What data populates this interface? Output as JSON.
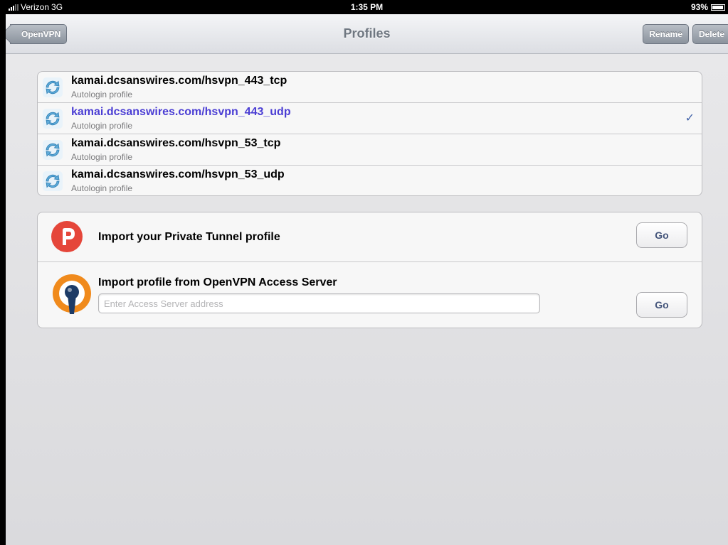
{
  "status_bar": {
    "carrier": "Verizon",
    "network": "3G",
    "time": "1:35 PM",
    "battery": "93%",
    "battery_level": 0.93
  },
  "nav": {
    "back_label": "OpenVPN",
    "title": "Profiles",
    "rename_label": "Rename",
    "delete_label": "Delete"
  },
  "profiles": [
    {
      "name": "kamai.dcsanswires.com/hsvpn_443_tcp",
      "subtitle": "Autologin profile",
      "selected": false,
      "icon": "refresh-icon"
    },
    {
      "name": "kamai.dcsanswires.com/hsvpn_443_udp",
      "subtitle": "Autologin profile",
      "selected": true,
      "icon": "refresh-icon"
    },
    {
      "name": "kamai.dcsanswires.com/hsvpn_53_tcp",
      "subtitle": "Autologin profile",
      "selected": false,
      "icon": "refresh-icon"
    },
    {
      "name": "kamai.dcsanswires.com/hsvpn_53_udp",
      "subtitle": "Autologin profile",
      "selected": false,
      "icon": "refresh-icon"
    }
  ],
  "checkmark": "✓",
  "imports": {
    "private_tunnel": {
      "title": "Import your Private Tunnel profile",
      "button": "Go",
      "icon": "private-tunnel-logo"
    },
    "access_server": {
      "title": "Import profile from OpenVPN Access Server",
      "placeholder": "Enter Access Server address",
      "value": "",
      "button": "Go",
      "icon": "openvpn-logo"
    }
  },
  "colors": {
    "selected_text": "#4b3ed4",
    "go_text": "#43547a",
    "private_tunnel_red": "#e5463a",
    "openvpn_orange": "#f08a1c",
    "openvpn_navy": "#1d3b66"
  }
}
